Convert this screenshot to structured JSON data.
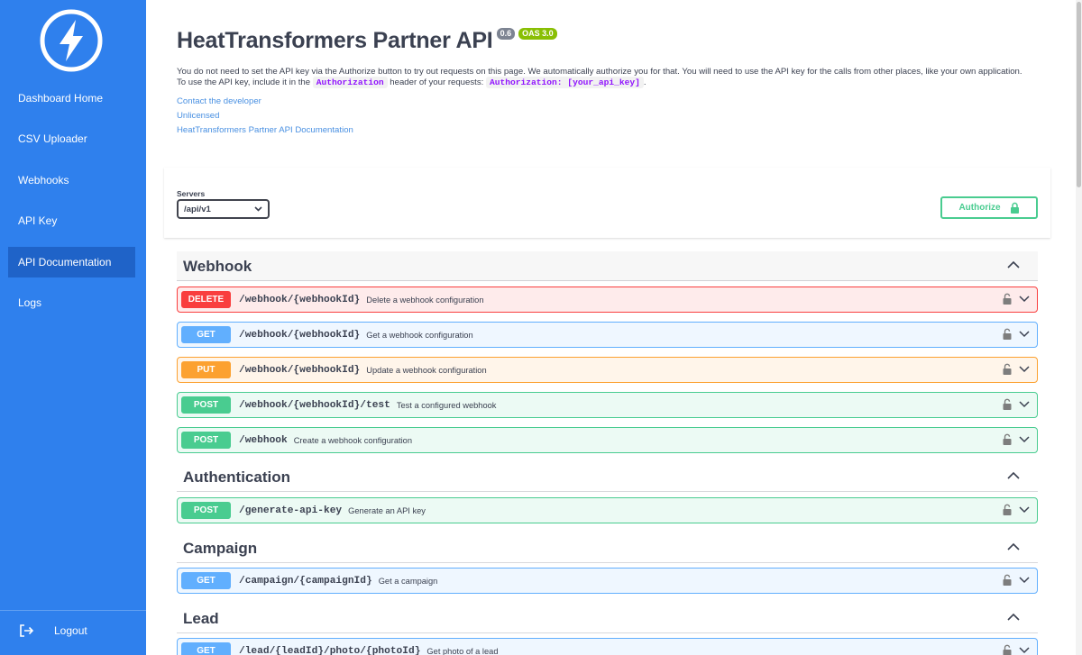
{
  "sidebar": {
    "items": [
      {
        "label": "Dashboard Home"
      },
      {
        "label": "CSV Uploader"
      },
      {
        "label": "Webhooks"
      },
      {
        "label": "API Key"
      },
      {
        "label": "API Documentation",
        "active": true
      },
      {
        "label": "Logs"
      }
    ],
    "logout_label": "Logout",
    "logo_icon": "lightning-bolt-icon",
    "color": "#2f80ed",
    "active_color": "#1f63c8"
  },
  "header": {
    "title": "HeatTransformers Partner API",
    "version_badge": "0.6",
    "oas_badge": "OAS 3.0"
  },
  "description": {
    "text1": "You do not need to set the API key via the Authorize button to try out requests on this page. We automatically authorize you for that. You will need to use the API key for the calls from other places, like your own application. To use the API key, include it in the",
    "code1": "Authorization",
    "text2": "header of your requests:",
    "code2": "Authorization: [your_api_key]",
    "text3": "."
  },
  "links": {
    "contact": "Contact the developer",
    "license": "Unlicensed",
    "docs": "HeatTransformers Partner API Documentation"
  },
  "servers": {
    "label": "Servers",
    "selected": "/api/v1"
  },
  "authorize_label": "Authorize",
  "tags": {
    "webhook": "Webhook",
    "authentication": "Authentication",
    "campaign": "Campaign",
    "lead": "Lead"
  },
  "operations": [
    {
      "method": "DELETE",
      "path": "/webhook/{webhookId}",
      "summary": "Delete a webhook configuration"
    },
    {
      "method": "GET",
      "path": "/webhook/{webhookId}",
      "summary": "Get a webhook configuration"
    },
    {
      "method": "PUT",
      "path": "/webhook/{webhookId}",
      "summary": "Update a webhook configuration"
    },
    {
      "method": "POST",
      "path": "/webhook/{webhookId}/test",
      "summary": "Test a configured webhook"
    },
    {
      "method": "POST",
      "path": "/webhook",
      "summary": "Create a webhook configuration"
    },
    {
      "method": "POST",
      "path": "/generate-api-key",
      "summary": "Generate an API key"
    },
    {
      "method": "GET",
      "path": "/campaign/{campaignId}",
      "summary": "Get a campaign"
    },
    {
      "method": "GET",
      "path": "/lead/{leadId}/photo/{photoId}",
      "summary": "Get photo of a lead"
    }
  ],
  "method_colors": {
    "DELETE": "#f93e3e",
    "GET": "#61affe",
    "PUT": "#fca130",
    "POST": "#49cc90"
  }
}
